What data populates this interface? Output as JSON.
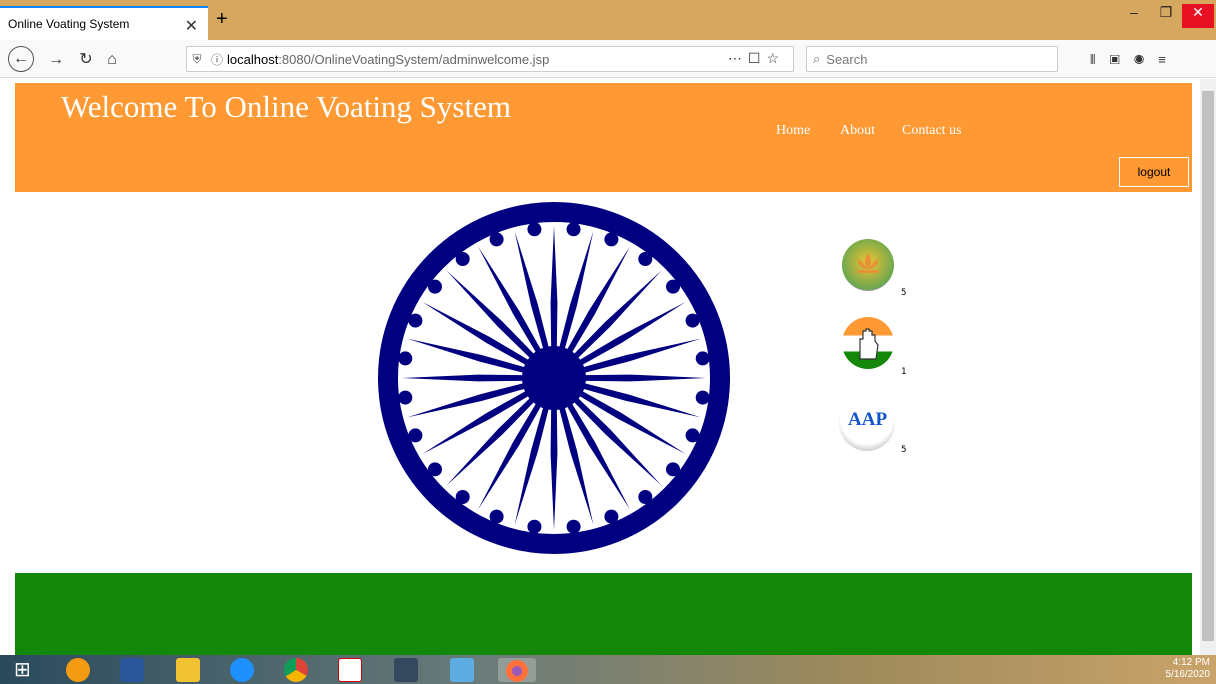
{
  "browser": {
    "tab_title": "Online Voating System",
    "url_host": "localhost",
    "url_path": ":8080/OnlineVoatingSystem/adminwelcome.jsp",
    "search_placeholder": "Search"
  },
  "header": {
    "title": "Welcome To Online Voating System",
    "nav": [
      "Home",
      "About",
      "Contact us"
    ],
    "logout_label": "logout"
  },
  "parties": [
    {
      "name": "bjp-logo-icon",
      "votes": "5"
    },
    {
      "name": "congress-logo-icon",
      "votes": "1"
    },
    {
      "name": "aap-logo-icon",
      "logo_text": "AAP",
      "votes": "5"
    }
  ],
  "taskbar": {
    "time": "4:12 PM",
    "date": "5/16/2020"
  },
  "colors": {
    "saffron": "#ff9933",
    "green": "#138808",
    "chakra": "#000080"
  }
}
